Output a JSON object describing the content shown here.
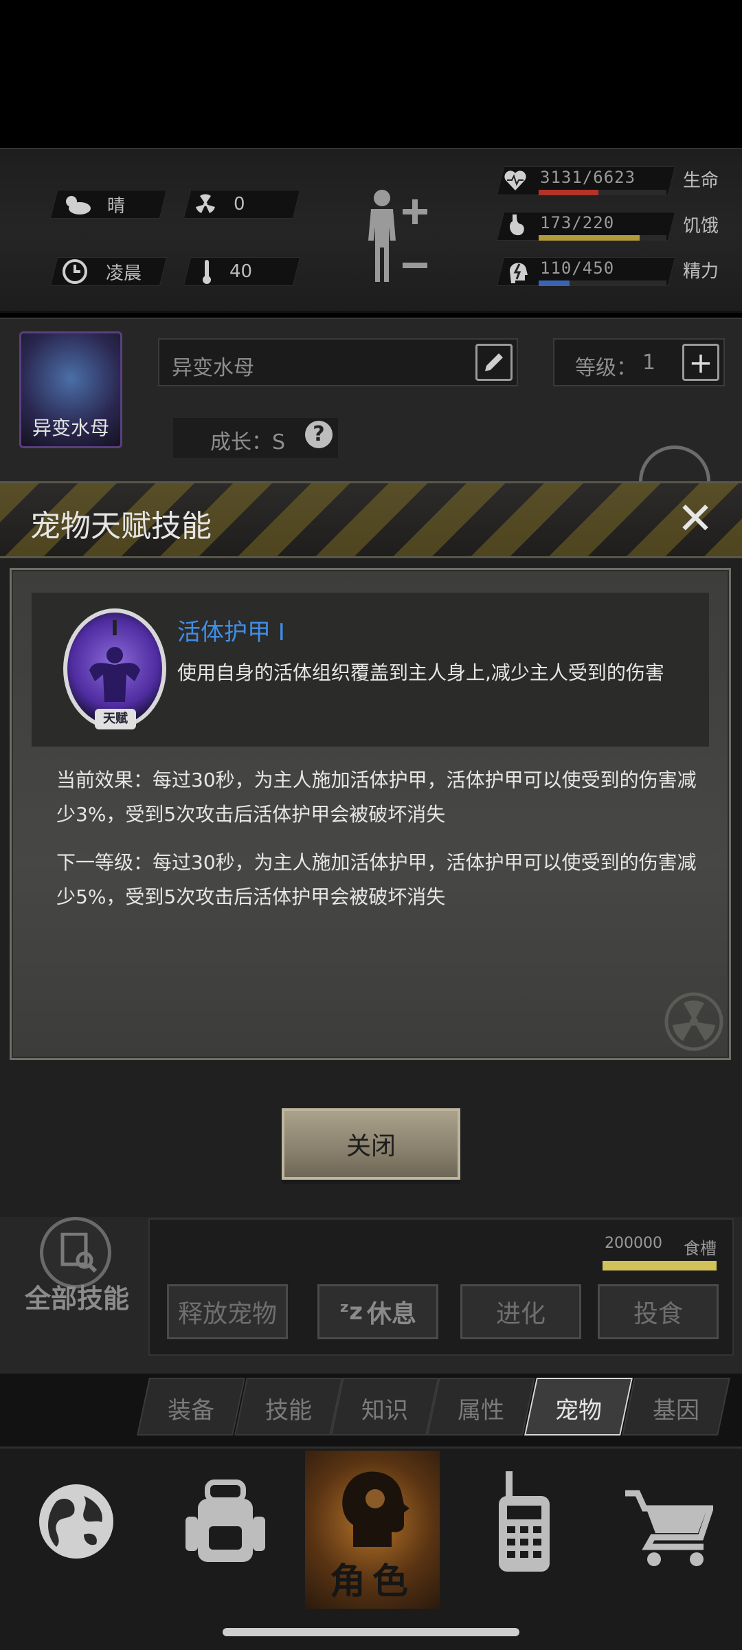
{
  "status": {
    "weather": "晴",
    "radiation": "0",
    "time": "凌晨",
    "temperature": "40",
    "stats": [
      {
        "value": "3131/6623",
        "label": "生命",
        "icon": "heart-pulse-icon",
        "fill": 0.47,
        "color": "#b3322a"
      },
      {
        "value": "173/220",
        "label": "饥饿",
        "icon": "stomach-icon",
        "fill": 0.79,
        "color": "#b39a3a"
      },
      {
        "value": "110/450",
        "label": "精力",
        "icon": "energy-head-icon",
        "fill": 0.24,
        "color": "#3a63b3"
      }
    ]
  },
  "pet": {
    "avatar_name": "异变水母",
    "name_input": "异变水母",
    "level_label": "等级：",
    "level_value": "1",
    "growth_label": "成长：S"
  },
  "modal": {
    "title": "宠物天赋技能",
    "skill": {
      "name": "活体护甲 I",
      "description": "使用自身的活体组织覆盖到主人身上,减少主人受到的伤害",
      "icon_numeral": "I",
      "icon_tag": "天赋"
    },
    "current_effect": "当前效果：每过30秒，为主人施加活体护甲，活体护甲可以使受到的伤害减少3%，受到5次攻击后活体护甲会被破坏消失",
    "next_level": "下一等级：每过30秒，为主人施加活体护甲，活体护甲可以使受到的伤害减少5%，受到5次攻击后活体护甲会被破坏消失",
    "close_label": "关闭"
  },
  "controls": {
    "all_skills": "全部技能",
    "food_value": "200000",
    "food_label": "食槽",
    "buttons": [
      "释放宠物",
      "休息",
      "进化",
      "投食"
    ]
  },
  "tabs": [
    "装备",
    "技能",
    "知识",
    "属性",
    "宠物",
    "基因"
  ],
  "nav": {
    "active_label": "角色"
  }
}
